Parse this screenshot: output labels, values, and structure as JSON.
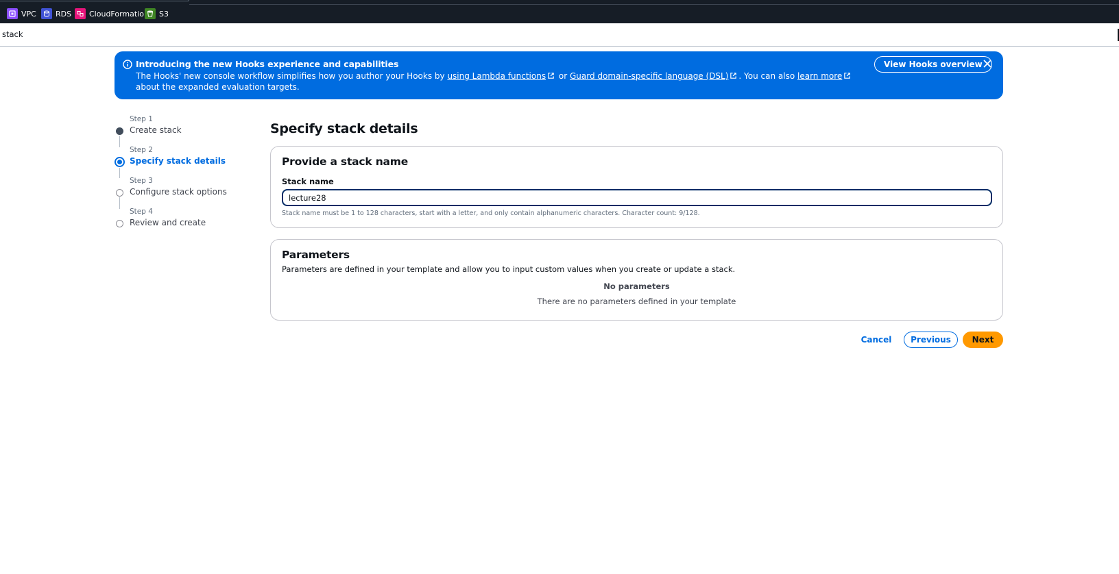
{
  "favorites": [
    {
      "label": "VPC",
      "icon": "vpc-icon",
      "color": "#8c4fff"
    },
    {
      "label": "RDS",
      "icon": "rds-icon",
      "color": "#4053d6"
    },
    {
      "label": "CloudFormation",
      "icon": "cloudformation-icon",
      "color": "#e7157b"
    },
    {
      "label": "S3",
      "icon": "s3-icon",
      "color": "#3f8624"
    }
  ],
  "breadcrumb": {
    "current": "stack"
  },
  "flash": {
    "title": "Introducing the new Hooks experience and capabilities",
    "body_prefix": "The Hooks' new console workflow simplifies how you author your Hooks by ",
    "link1": "using Lambda functions",
    "body_or": " or ",
    "link2": "Guard domain-specific language (DSL)",
    "body_mid": ". You can also ",
    "link3": "learn more",
    "body_suffix": " about the expanded evaluation targets.",
    "action_label": "View Hooks overview",
    "background_color": "#006ce0"
  },
  "wizard": {
    "steps": [
      {
        "label": "Step 1",
        "name": "Create stack",
        "state": "done"
      },
      {
        "label": "Step 2",
        "name": "Specify stack details",
        "state": "active"
      },
      {
        "label": "Step 3",
        "name": "Configure stack options",
        "state": "todo"
      },
      {
        "label": "Step 4",
        "name": "Review and create",
        "state": "todo"
      }
    ]
  },
  "page_title": "Specify stack details",
  "stack_name_section": {
    "heading": "Provide a stack name",
    "field_label": "Stack name",
    "field_value": "lecture28",
    "hint": "Stack name must be 1 to 128 characters, start with a letter, and only contain alphanumeric characters. Character count: 9/128."
  },
  "parameters_section": {
    "heading": "Parameters",
    "description": "Parameters are defined in your template and allow you to input custom values when you create or update a stack.",
    "empty_title": "No parameters",
    "empty_description": "There are no parameters defined in your template"
  },
  "actions": {
    "cancel": "Cancel",
    "previous": "Previous",
    "next": "Next",
    "primary_color": "#ff9900"
  }
}
